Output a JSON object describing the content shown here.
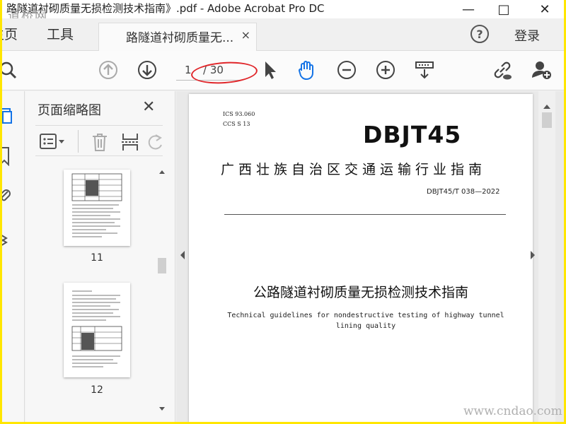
{
  "window": {
    "title": "路隧道衬砌质量无损检测技术指南》.pdf - Adobe Acrobat Pro DC",
    "watermark_logo": "道桥网",
    "controls": [
      "—",
      "□",
      "✕"
    ]
  },
  "tabs": {
    "home": "主页",
    "tools": "工具",
    "document": "路隧道衬砌质量无...",
    "document_close": "×",
    "help": "?",
    "login": "登录"
  },
  "toolbar": {
    "page_current": "1",
    "page_total": "/ 30",
    "icons": [
      "search-icon",
      "page-up-icon",
      "page-down-icon",
      "select-cursor-icon",
      "hand-tool-icon",
      "zoom-out-icon",
      "zoom-in-icon",
      "scroll-mode-icon",
      "share-link-icon",
      "add-user-icon"
    ]
  },
  "panel": {
    "title": "页面缩略图",
    "close": "✕",
    "thumbnails": [
      {
        "page_label": "11"
      },
      {
        "page_label": "12"
      }
    ]
  },
  "document": {
    "ics_line": "ICS  93.060",
    "ccs_line": "CCS  S 13",
    "code": "DBJT45",
    "issuer": "广西壮族自治区交通运输行业指南",
    "standard_no": "DBJT45/T 038—2022",
    "title_cn": "公路隧道衬砌质量无损检测技术指南",
    "title_en": "Technical guidelines for nondestructive testing of highway tunnel lining quality"
  },
  "site_watermark": "www.cndao.com",
  "colors": {
    "border": "#ffe600",
    "accent_blue": "#1473e6",
    "annotation_red": "#e0262a"
  }
}
